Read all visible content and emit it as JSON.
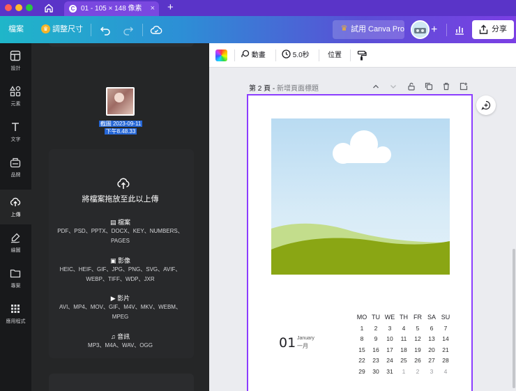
{
  "browser": {
    "tab_title": "01 - 105 × 148 像素",
    "tab_close": "×",
    "new_tab": "+",
    "traffic_lights": [
      "#ff5f57",
      "#febc2e",
      "#28c840"
    ]
  },
  "topbar": {
    "file_menu": "檔案",
    "resize_label": "調整尺寸",
    "try_pro_label": "試用 Canva Pro",
    "add_label": "+",
    "share_label": "分享",
    "accent_gradient": [
      "#1fb6c9",
      "#7b3fe4"
    ]
  },
  "rail": {
    "items": [
      {
        "label": "設計",
        "icon": "design-icon"
      },
      {
        "label": "元素",
        "icon": "elements-icon"
      },
      {
        "label": "文字",
        "icon": "text-icon"
      },
      {
        "label": "品牌",
        "icon": "brand-icon"
      },
      {
        "label": "上傳",
        "icon": "upload-icon",
        "active": true
      },
      {
        "label": "繪圖",
        "icon": "draw-icon"
      },
      {
        "label": "專案",
        "icon": "folder-icon"
      },
      {
        "label": "應用程式",
        "icon": "apps-icon"
      }
    ]
  },
  "panel": {
    "upload_file_name_line1": "截圖 2023-09-11",
    "upload_file_name_line2": "下午8.48.33",
    "drop_title": "將檔案拖放至此以上傳",
    "sections": [
      {
        "icon": "document-icon",
        "title": "檔案",
        "types": [
          "PDF、PSD、PPTX、DOCX、KEY、NUMBERS、",
          "PAGES"
        ]
      },
      {
        "icon": "image-icon",
        "title": "影像",
        "types": [
          "HEIC、HEIF、GIF、JPG、PNG、SVG、AVIF、",
          "WEBP、TIFF、WDP、JXR"
        ]
      },
      {
        "icon": "video-icon",
        "title": "影片",
        "types": [
          "AVI、MP4、MOV、GIF、M4V、MKV、WEBM、",
          "MPEG"
        ]
      },
      {
        "icon": "audio-icon",
        "title": "音訊",
        "types": [
          "MP3、M4A、WAV、OGG"
        ]
      }
    ]
  },
  "canvas_toolbar": {
    "animate_label": "動畫",
    "duration_label": "5.0秒",
    "position_label": "位置"
  },
  "page": {
    "page_number_label": "第 2 頁",
    "page_title_placeholder": "新增頁面標題",
    "page_title_sep": " - "
  },
  "calendar": {
    "day_number": "01",
    "month_en": "January",
    "month_zh": "一月",
    "weekdays": [
      "MO",
      "TU",
      "WE",
      "TH",
      "FR",
      "SA",
      "SU"
    ],
    "weeks": [
      [
        {
          "d": "1"
        },
        {
          "d": "2"
        },
        {
          "d": "3"
        },
        {
          "d": "4"
        },
        {
          "d": "5"
        },
        {
          "d": "6"
        },
        {
          "d": "7"
        }
      ],
      [
        {
          "d": "8"
        },
        {
          "d": "9"
        },
        {
          "d": "10"
        },
        {
          "d": "11"
        },
        {
          "d": "12"
        },
        {
          "d": "13"
        },
        {
          "d": "14"
        }
      ],
      [
        {
          "d": "15"
        },
        {
          "d": "16"
        },
        {
          "d": "17"
        },
        {
          "d": "18"
        },
        {
          "d": "19"
        },
        {
          "d": "20"
        },
        {
          "d": "21"
        }
      ],
      [
        {
          "d": "22"
        },
        {
          "d": "23"
        },
        {
          "d": "24"
        },
        {
          "d": "25"
        },
        {
          "d": "26"
        },
        {
          "d": "27"
        },
        {
          "d": "28"
        }
      ],
      [
        {
          "d": "29"
        },
        {
          "d": "30"
        },
        {
          "d": "31"
        },
        {
          "d": "1",
          "muted": true
        },
        {
          "d": "2",
          "muted": true
        },
        {
          "d": "3",
          "muted": true
        },
        {
          "d": "4",
          "muted": true
        }
      ]
    ]
  }
}
